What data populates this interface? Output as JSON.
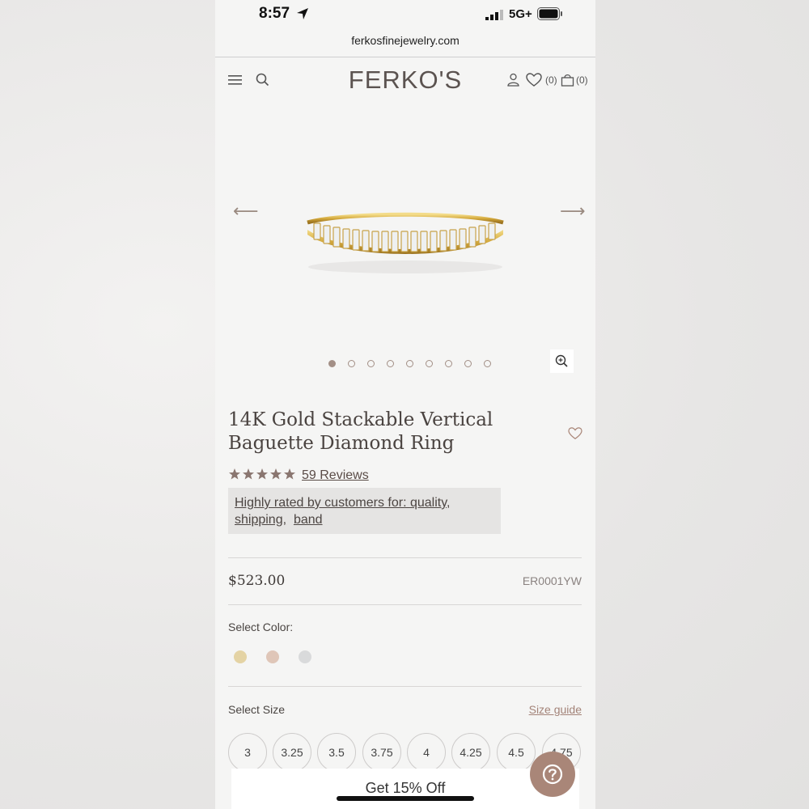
{
  "status_bar": {
    "time": "8:57",
    "network": "5G+"
  },
  "browser": {
    "url": "ferkosfinejewelry.com"
  },
  "header": {
    "logo": "FERKO'S",
    "wishlist_count": "(0)",
    "cart_count": "(0)"
  },
  "gallery": {
    "prev_arrow": "⟵",
    "next_arrow": "⟶",
    "image_count": 9,
    "active_image": 1
  },
  "product": {
    "title_line1": "14K Gold Stackable Vertical",
    "title_line2": "Baguette Diamond Ring",
    "rating": 5,
    "reviews_label": "59 Reviews",
    "highlight_prefix": "Highly rated by customers for: ",
    "highlight_terms": [
      "quality,",
      "shipping,",
      "band"
    ],
    "price": "$523.00",
    "sku": "ER0001YW",
    "select_color_label": "Select Color:",
    "colors": [
      {
        "name": "yellow gold",
        "hex": "#e4d3a4"
      },
      {
        "name": "rose gold",
        "hex": "#dfc6b8"
      },
      {
        "name": "white gold",
        "hex": "#d9dadb"
      }
    ],
    "select_size_label": "Select Size",
    "size_guide_label": "Size guide",
    "sizes": [
      "3",
      "3.25",
      "3.5",
      "3.75",
      "4",
      "4.25",
      "4.5",
      "4.75"
    ]
  },
  "promo": {
    "label": "Get 15% Off"
  },
  "help": {
    "icon": "question-icon"
  },
  "colors": {
    "accent": "#a98678",
    "text": "#4a4340"
  }
}
